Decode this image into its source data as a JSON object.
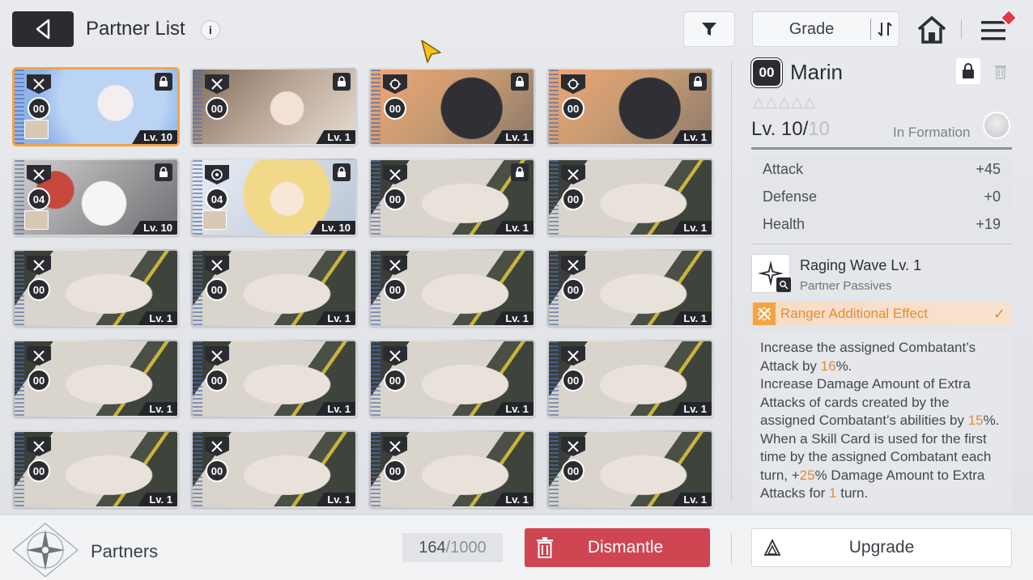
{
  "header": {
    "title": "Partner List",
    "info_glyph": "i",
    "sort_label": "Grade"
  },
  "partners": [
    {
      "grade": "00",
      "level": "Lv. 10",
      "class_icon": "crossed-swords-icon",
      "locked": true,
      "art": "blue",
      "selected": true,
      "in_formation": true
    },
    {
      "grade": "00",
      "level": "Lv. 1",
      "class_icon": "crossed-swords-icon",
      "locked": true,
      "art": "brown"
    },
    {
      "grade": "00",
      "level": "Lv. 1",
      "class_icon": "target-icon",
      "locked": true,
      "art": "dark"
    },
    {
      "grade": "00",
      "level": "Lv. 1",
      "class_icon": "target-icon",
      "locked": true,
      "art": "dark"
    },
    {
      "grade": "04",
      "level": "Lv. 10",
      "class_icon": "crossed-swords-icon",
      "locked": true,
      "art": "white",
      "in_formation": true
    },
    {
      "grade": "04",
      "level": "Lv. 10",
      "class_icon": "circle-target-icon",
      "locked": true,
      "art": "blonde",
      "in_formation": true
    },
    {
      "grade": "00",
      "level": "Lv. 1",
      "class_icon": "crossed-swords-icon",
      "locked": true,
      "art": "gray"
    },
    {
      "grade": "00",
      "level": "Lv. 1",
      "class_icon": "crossed-swords-icon",
      "locked": false,
      "art": "gray"
    },
    {
      "grade": "00",
      "level": "Lv. 1",
      "class_icon": "crossed-swords-icon",
      "locked": false,
      "art": "gray"
    },
    {
      "grade": "00",
      "level": "Lv. 1",
      "class_icon": "crossed-swords-icon",
      "locked": false,
      "art": "gray"
    },
    {
      "grade": "00",
      "level": "Lv. 1",
      "class_icon": "crossed-swords-icon",
      "locked": false,
      "art": "gray"
    },
    {
      "grade": "00",
      "level": "Lv. 1",
      "class_icon": "crossed-swords-icon",
      "locked": false,
      "art": "gray"
    },
    {
      "grade": "00",
      "level": "Lv. 1",
      "class_icon": "crossed-swords-icon",
      "locked": false,
      "art": "gray"
    },
    {
      "grade": "00",
      "level": "Lv. 1",
      "class_icon": "crossed-swords-icon",
      "locked": false,
      "art": "gray"
    },
    {
      "grade": "00",
      "level": "Lv. 1",
      "class_icon": "crossed-swords-icon",
      "locked": false,
      "art": "gray"
    },
    {
      "grade": "00",
      "level": "Lv. 1",
      "class_icon": "crossed-swords-icon",
      "locked": false,
      "art": "gray"
    },
    {
      "grade": "00",
      "level": "Lv. 1",
      "class_icon": "crossed-swords-icon",
      "locked": false,
      "art": "gray"
    },
    {
      "grade": "00",
      "level": "Lv. 1",
      "class_icon": "crossed-swords-icon",
      "locked": false,
      "art": "gray"
    },
    {
      "grade": "00",
      "level": "Lv. 1",
      "class_icon": "crossed-swords-icon",
      "locked": false,
      "art": "gray"
    },
    {
      "grade": "00",
      "level": "Lv. 1",
      "class_icon": "crossed-swords-icon",
      "locked": false,
      "art": "gray"
    }
  ],
  "detail": {
    "grade": "00",
    "name": "Marin",
    "stars_total": 5,
    "stars_filled": 0,
    "level_current": "Lv. 10",
    "level_max": "10",
    "level_fill": 1.0,
    "formation_label": "In Formation",
    "stats": [
      {
        "label": "Attack",
        "value": "+45"
      },
      {
        "label": "Defense",
        "value": "+0"
      },
      {
        "label": "Health",
        "value": "+19"
      }
    ],
    "skill_name": "Raging Wave Lv. 1",
    "skill_type": "Partner Passives",
    "effect_label": "Ranger Additional Effect",
    "description": [
      {
        "t": "Increase the assigned Combatant’s Attack by "
      },
      {
        "t": "16",
        "hl": true
      },
      {
        "t": "%."
      },
      {
        "t": "\nIncrease Damage Amount of Extra Attacks of cards created by the assigned Combatant’s abilities by "
      },
      {
        "t": "15",
        "hl": true
      },
      {
        "t": "%."
      },
      {
        "t": "\nWhen a Skill Card is used for the first time by the assigned Combatant each turn, +"
      },
      {
        "t": "25",
        "hl": true
      },
      {
        "t": "% Damage Amount to Extra Attacks for "
      },
      {
        "t": "1",
        "hl": true
      },
      {
        "t": " turn."
      }
    ]
  },
  "footer": {
    "section_label": "Partners",
    "count_current": "164",
    "count_sep": " / ",
    "count_total": "1000",
    "dismantle_label": "Dismantle",
    "upgrade_label": "Upgrade"
  },
  "colors": {
    "accent_orange": "#e58c34",
    "dismantle_red": "#cf4552",
    "dark": "#2a2c31",
    "selected_border": "#f2a444"
  }
}
